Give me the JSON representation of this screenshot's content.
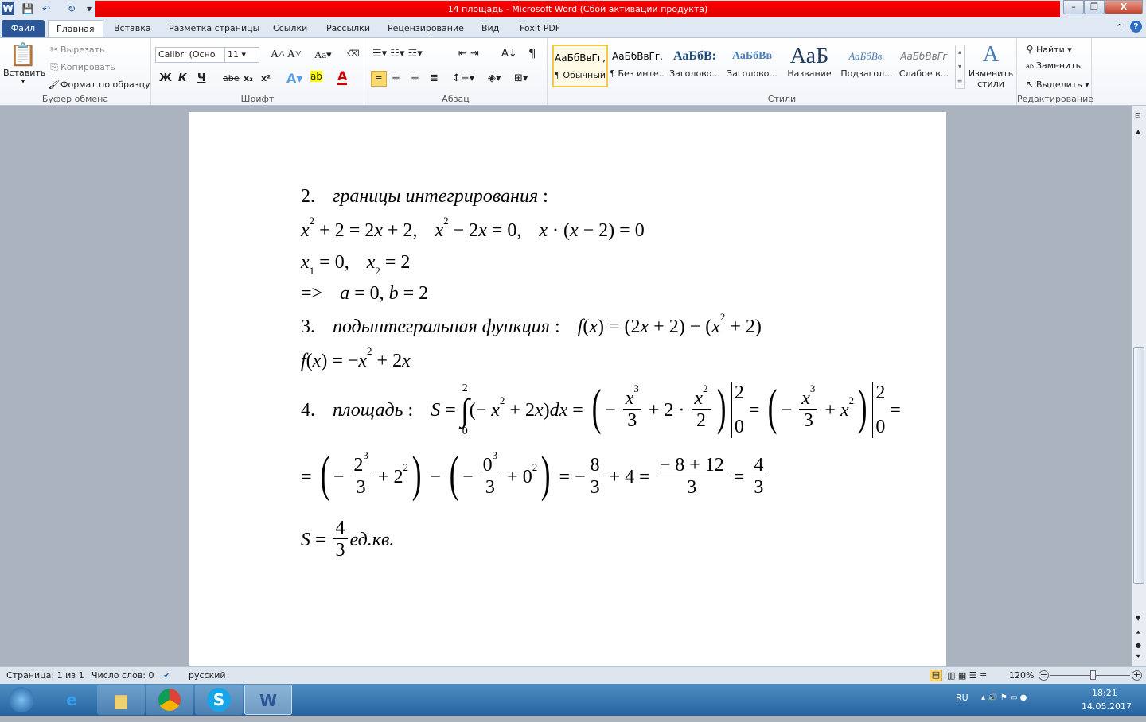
{
  "titlebar": {
    "title": "14 площадь  -  Microsoft Word (Сбой активации продукта)",
    "minimize": "–",
    "restore": "❐",
    "close": "X"
  },
  "tabs": [
    "Файл",
    "Главная",
    "Вставка",
    "Разметка страницы",
    "Ссылки",
    "Рассылки",
    "Рецензирование",
    "Вид",
    "Foxit PDF"
  ],
  "ribbon": {
    "clipboard": {
      "label": "Буфер обмена",
      "paste": "Вставить",
      "cut": "Вырезать",
      "copy": "Копировать",
      "format_painter": "Формат по образцу"
    },
    "font": {
      "label": "Шрифт",
      "font_name": "Calibri (Осно",
      "font_size": "11",
      "bold": "Ж",
      "italic": "К",
      "underline": "Ч",
      "strike": "abe",
      "sub": "x₂",
      "sup": "x²",
      "case": "Aa"
    },
    "paragraph": {
      "label": "Абзац",
      "pilcrow": "¶"
    },
    "styles": {
      "label": "Стили",
      "items": [
        {
          "preview": "АаБбВвГг,",
          "name": "¶ Обычный"
        },
        {
          "preview": "АаБбВвГг,",
          "name": "¶ Без инте..."
        },
        {
          "preview": "АаБбВ:",
          "name": "Заголово..."
        },
        {
          "preview": "АаБбВв",
          "name": "Заголово..."
        },
        {
          "preview": "АаБ",
          "name": "Название"
        },
        {
          "preview": "АаБбВв.",
          "name": "Подзагол..."
        },
        {
          "preview": "АаБбВвГг",
          "name": "Слабое в..."
        }
      ],
      "change_styles": "Изменить стили"
    },
    "editing": {
      "label": "Редактирование",
      "find": "Найти",
      "replace": "Заменить",
      "select": "Выделить"
    }
  },
  "document": {
    "lines": [
      [
        "2.",
        {
          "tab": 1
        },
        {
          "i": "границы интегрирования"
        },
        " :"
      ],
      [
        {
          "sup": [
            "x",
            "2"
          ]
        },
        " + 2 = 2",
        {
          "i": "x"
        },
        " + 2,",
        {
          "tab": 1
        },
        {
          "sup": [
            "x",
            "2"
          ]
        },
        " − 2",
        {
          "i": "x"
        },
        " = 0,",
        {
          "tab": 1
        },
        {
          "i": "x"
        },
        " · (",
        {
          "i": "x"
        },
        " − 2) = 0"
      ],
      [
        {
          "sub": [
            "x",
            "1"
          ]
        },
        " = 0,",
        {
          "tab": 1
        },
        {
          "sub": [
            "x",
            "2"
          ]
        },
        " = 2"
      ],
      [
        "=>",
        {
          "tab": 1
        },
        {
          "i": "a"
        },
        " = 0, ",
        {
          "i": "b"
        },
        " = 2"
      ],
      [
        "3.",
        {
          "tab": 1
        },
        {
          "i": "подынтегральная функция"
        },
        " :",
        {
          "tab": 1
        },
        {
          "i": "f"
        },
        "(",
        {
          "i": "x"
        },
        ") = (2",
        {
          "i": "x"
        },
        " + 2) − (",
        {
          "sup": [
            "x",
            "2"
          ]
        },
        " + 2)"
      ],
      [
        {
          "i": "f"
        },
        "(",
        {
          "i": "x"
        },
        ") = −",
        {
          "sup": [
            "x",
            "2"
          ]
        },
        " + 2",
        {
          "i": "x"
        }
      ],
      [
        "4.",
        {
          "tab": 1
        },
        {
          "i": "площадь"
        },
        " :",
        {
          "tab": 1
        },
        {
          "i": "S"
        },
        " = ",
        {
          "int": [
            "0",
            "2"
          ]
        },
        "(− ",
        {
          "sup": [
            "x",
            "2"
          ]
        },
        " + 2",
        {
          "i": "x"
        },
        ")",
        {
          "i": "dx"
        },
        " = ",
        {
          "paren": [
            "− ",
            {
              "frac": [
                [
                  {
                    "sup": [
                      "x",
                      "3"
                    ]
                  }
                ],
                [
                  "3"
                ]
              ]
            },
            " + 2 · ",
            {
              "frac": [
                [
                  {
                    "sup": [
                      "x",
                      "2"
                    ]
                  }
                ],
                [
                  "2"
                ]
              ]
            }
          ]
        },
        {
          "bar": [
            "2",
            "0"
          ]
        },
        " = ",
        {
          "paren": [
            "− ",
            {
              "frac": [
                [
                  {
                    "sup": [
                      "x",
                      "3"
                    ]
                  }
                ],
                [
                  "3"
                ]
              ]
            },
            " + ",
            {
              "sup": [
                "x",
                "2"
              ]
            }
          ]
        },
        {
          "bar": [
            "2",
            "0"
          ]
        },
        " ="
      ],
      [
        "= ",
        {
          "paren": [
            "− ",
            {
              "frac": [
                [
                  {
                    "supn": [
                      "2",
                      "3"
                    ]
                  }
                ],
                [
                  "3"
                ]
              ]
            },
            " + ",
            {
              "supn": [
                "2",
                "2"
              ]
            }
          ]
        },
        " − ",
        {
          "paren": [
            "− ",
            {
              "frac": [
                [
                  {
                    "supn": [
                      "0",
                      "3"
                    ]
                  }
                ],
                [
                  "3"
                ]
              ]
            },
            " + ",
            {
              "supn": [
                "0",
                "2"
              ]
            }
          ]
        },
        " = −",
        {
          "frac": [
            [
              "8"
            ],
            [
              "3"
            ]
          ]
        },
        " + 4 = ",
        {
          "frac": [
            [
              "− 8 + 12"
            ],
            [
              "3"
            ]
          ]
        },
        " = ",
        {
          "frac": [
            [
              "4"
            ],
            [
              "3"
            ]
          ]
        }
      ],
      [
        {
          "i": "S"
        },
        " = ",
        {
          "frac": [
            [
              "4"
            ],
            [
              "3"
            ]
          ]
        },
        {
          "i": "ед.кв."
        }
      ]
    ]
  },
  "statusbar": {
    "page": "Страница: 1 из 1",
    "words": "Число слов: 0",
    "language": "русский",
    "zoom": "120%",
    "zoom_percent": 120
  },
  "taskbar": {
    "lang": "RU",
    "time": "18:21",
    "date": "14.05.2017"
  }
}
